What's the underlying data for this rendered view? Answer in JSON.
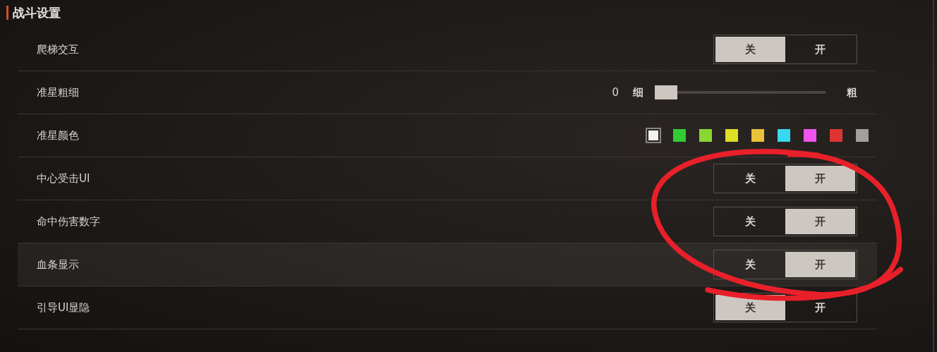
{
  "section_title": "战斗设置",
  "settings": [
    {
      "kind": "toggle",
      "label": "爬梯交互",
      "highlighted": false,
      "options": [
        {
          "label": "关",
          "selected": true
        },
        {
          "label": "开",
          "selected": false
        }
      ]
    },
    {
      "kind": "slider",
      "label": "准星粗细",
      "highlighted": false,
      "reading": "0",
      "min_label": "细",
      "max_label": "粗",
      "level": 0
    },
    {
      "kind": "colors",
      "label": "准星颜色",
      "highlighted": false,
      "swatches": [
        {
          "color": "#f2f2f2",
          "selected": true
        },
        {
          "color": "#33cc33",
          "selected": false
        },
        {
          "color": "#8ad633",
          "selected": false
        },
        {
          "color": "#dede24",
          "selected": false
        },
        {
          "color": "#e8c23a",
          "selected": false
        },
        {
          "color": "#38d8ee",
          "selected": false
        },
        {
          "color": "#ee55ee",
          "selected": false
        },
        {
          "color": "#e03434",
          "selected": false
        },
        {
          "color": "#a0a0a0",
          "selected": false
        }
      ]
    },
    {
      "kind": "toggle",
      "label": "中心受击UI",
      "highlighted": false,
      "options": [
        {
          "label": "关",
          "selected": false
        },
        {
          "label": "开",
          "selected": true
        }
      ]
    },
    {
      "kind": "toggle",
      "label": "命中伤害数字",
      "highlighted": false,
      "options": [
        {
          "label": "关",
          "selected": false
        },
        {
          "label": "开",
          "selected": true
        }
      ]
    },
    {
      "kind": "toggle",
      "label": "血条显示",
      "highlighted": true,
      "options": [
        {
          "label": "关",
          "selected": false
        },
        {
          "label": "开",
          "selected": true
        }
      ]
    },
    {
      "kind": "toggle",
      "label": "引导UI显隐",
      "highlighted": false,
      "options": [
        {
          "label": "关",
          "selected": true
        },
        {
          "label": "开",
          "selected": false
        }
      ]
    }
  ]
}
